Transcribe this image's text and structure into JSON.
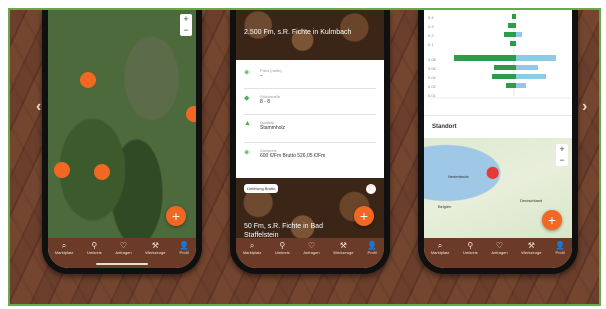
{
  "tabs": [
    {
      "icon": "magnifier-icon",
      "glyph": "⌕",
      "label": "Marktplatz"
    },
    {
      "icon": "pin-icon",
      "glyph": "⚲",
      "label": "Umkreis"
    },
    {
      "icon": "heart-icon",
      "glyph": "♡",
      "label": "Anfragen"
    },
    {
      "icon": "tools-icon",
      "glyph": "⚒",
      "label": "Werkzeuge"
    },
    {
      "icon": "user-icon",
      "glyph": "👤",
      "label": "Profil"
    }
  ],
  "phone1": {
    "zoom_in": "+",
    "zoom_out": "−",
    "fab": "+"
  },
  "phone2": {
    "header_title": "2.500 Fm, s.R. Fichte in Kulmbach",
    "details": [
      {
        "icon": "tag-icon",
        "glyph": "◈",
        "label": "Preis (netto)",
        "value": "–"
      },
      {
        "icon": "ruler-icon",
        "glyph": "◆",
        "label": "Stückmaße",
        "value": "8 - 8"
      },
      {
        "icon": "tree-icon",
        "glyph": "▲",
        "label": "Qualität",
        "value": "Stammholz"
      },
      {
        "icon": "tag2-icon",
        "glyph": "◈",
        "label": "Zahlpreis",
        "value": "600 €/Fm  Brutto  526,05 €/Fm"
      }
    ],
    "card_badge": "Lieferung Brutto",
    "card_title": "50 Fm, s.R. Fichte in Bad Staffelstein",
    "fab": "+"
  },
  "phone3": {
    "ticks": [
      "0.4",
      "0.3",
      "0.2",
      "0.1",
      "0.08",
      "0.06",
      "0.04",
      "0.02",
      "0.01"
    ],
    "section_title": "Standort",
    "map_labels": [
      "Nederlande",
      "Belgien",
      "Deutschland"
    ],
    "zoom_in": "+",
    "zoom_out": "−",
    "fab": "+"
  },
  "nav": {
    "prev": "‹",
    "next": "›"
  },
  "colors": {
    "accent": "#f26822",
    "brown": "#6b3b27",
    "green": "#4caf50",
    "bar_green": "#2e9b4b",
    "bar_blue": "#8ec9e8"
  }
}
